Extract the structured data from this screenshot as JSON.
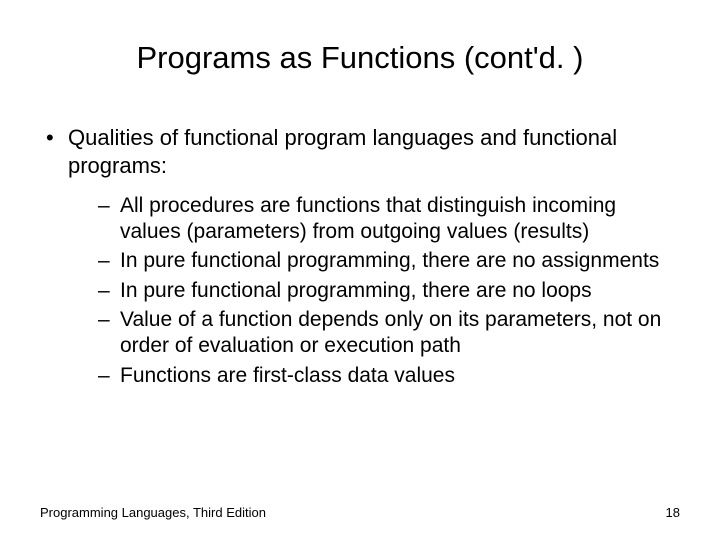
{
  "title": "Programs as Functions (cont'd. )",
  "main_bullet": "Qualities of functional program languages and functional programs:",
  "sub_bullets": {
    "b0": "All procedures are functions that distinguish incoming values (parameters) from outgoing values (results)",
    "b1": "In pure functional programming, there are no assignments",
    "b2": "In pure functional programming, there are no loops",
    "b3": "Value of a function depends only on its parameters, not on order of evaluation or execution path",
    "b4": "Functions are first-class data values"
  },
  "footer_left": "Programming Languages, Third Edition",
  "footer_right": "18"
}
